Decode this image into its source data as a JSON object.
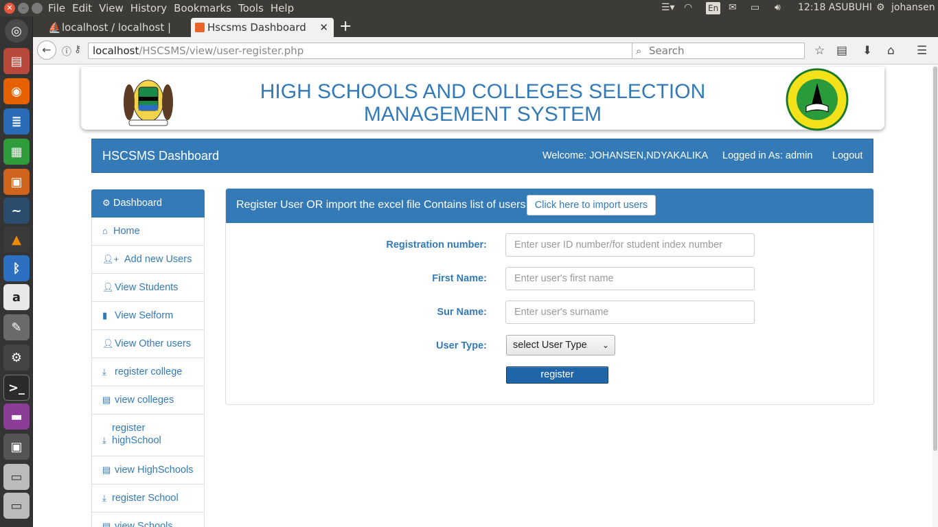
{
  "os": {
    "menu": [
      "File",
      "Edit",
      "View",
      "History",
      "Bookmarks",
      "Tools",
      "Help"
    ],
    "keyboard": "En",
    "time": "12:18 ASUBUHI",
    "user": "johansen"
  },
  "browser": {
    "tabs": [
      {
        "label": "localhost / localhost | ",
        "active": false
      },
      {
        "label": "Hscsms Dashboard",
        "active": true
      }
    ],
    "url_host": "localhost",
    "url_path": "/HSCSMS/view/user-register.php",
    "search_placeholder": "Search"
  },
  "banner": {
    "title": "HIGH SCHOOLS AND COLLEGES SELECTION MANAGEMENT SYSTEM"
  },
  "header": {
    "brand": "HSCSMS Dashboard",
    "welcome": "Welcome: JOHANSEN,NDYAKALIKA",
    "logged_in": "Logged in As: admin",
    "logout": "Logout"
  },
  "sidebar": {
    "items": [
      {
        "label": "Dashboard",
        "icon": "gear-icon"
      },
      {
        "label": "Home",
        "icon": "home-icon"
      },
      {
        "label": "Add new Users",
        "icon": "user-plus-icon"
      },
      {
        "label": "View Students",
        "icon": "user-icon"
      },
      {
        "label": "View Selform",
        "icon": "book-icon"
      },
      {
        "label": "View Other users",
        "icon": "user-icon"
      },
      {
        "label": "register college",
        "icon": "download-icon"
      },
      {
        "label": "view colleges",
        "icon": "file-icon"
      },
      {
        "label": "register highSchool",
        "icon": "download-icon"
      },
      {
        "label": "view HighSchools",
        "icon": "file-icon"
      },
      {
        "label": "register School",
        "icon": "download-icon"
      },
      {
        "label": "view Schools",
        "icon": "file-icon"
      }
    ]
  },
  "panel": {
    "title": "Register User OR import the excel file Contains list of users",
    "import_button": "Click here to import users"
  },
  "form": {
    "reg_label": "Registration number:",
    "reg_placeholder": "Enter user ID number/for student index number",
    "first_label": "First Name:",
    "first_placeholder": "Enter user's first name",
    "sur_label": "Sur Name:",
    "sur_placeholder": "Enter user's surname",
    "type_label": "User Type:",
    "type_selected": "select User Type",
    "submit": "register"
  },
  "colors": {
    "primary": "#337ab7",
    "button": "#1f66a8"
  }
}
